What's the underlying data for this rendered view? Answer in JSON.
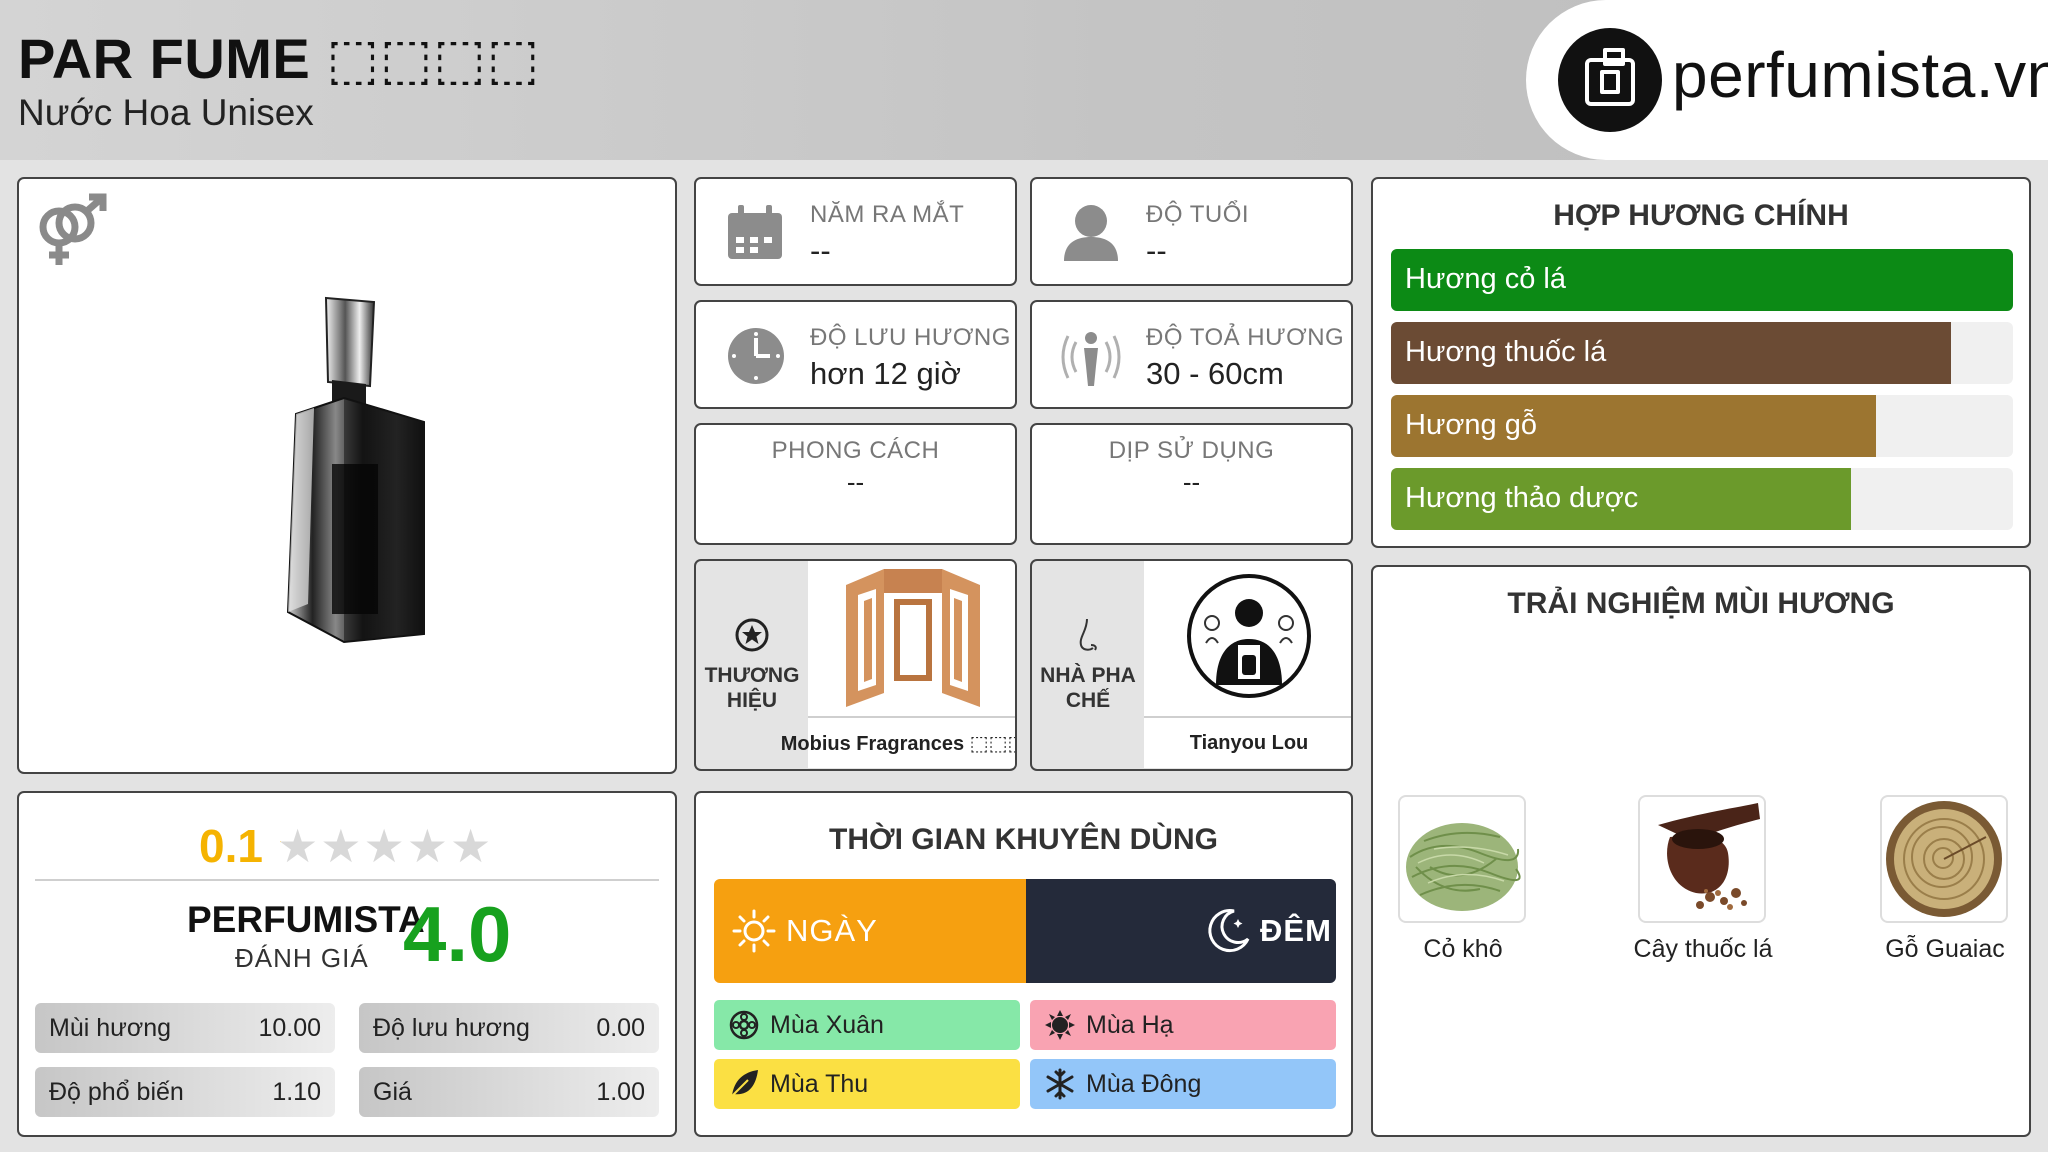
{
  "header": {
    "product_name": "PAR FUME ⬚⬚⬚⬚",
    "product_type": "Nước Hoa Unisex",
    "logo_text": "perfumista.vn"
  },
  "info": {
    "release_year": {
      "label": "NĂM RA MẮT",
      "value": "--",
      "icon": "calendar-icon"
    },
    "age": {
      "label": "ĐỘ TUỔI",
      "value": "--",
      "icon": "person-icon"
    },
    "longevity": {
      "label": "ĐỘ LƯU HƯƠNG",
      "value": "hơn 12 giờ",
      "icon": "clock-icon"
    },
    "sillage": {
      "label": "ĐỘ TOẢ HƯƠNG",
      "value": "30 - 60cm",
      "icon": "sillage-icon"
    },
    "style": {
      "label": "PHONG CÁCH",
      "value": "--"
    },
    "occasion": {
      "label": "DỊP SỬ DỤNG",
      "value": "--"
    }
  },
  "brand": {
    "label": "THƯƠNG HIỆU",
    "name": "Mobius Fragrances ⬚⬚⬚⬚",
    "icon": "star-badge-icon"
  },
  "perfumer": {
    "label": "NHÀ PHA CHẾ",
    "name": "Tianyou Lou",
    "icon": "nose-icon"
  },
  "rating": {
    "user_score": "0.1",
    "user_stars": "★★★★★",
    "user_star_fraction": 0.02,
    "perfumista_label": "PERFUMISTA",
    "perfumista_sub": "ĐÁNH GIÁ",
    "perfumista_score": "4.0",
    "metrics": [
      {
        "label": "Mùi hương",
        "value": "10.00"
      },
      {
        "label": "Độ lưu hương",
        "value": "0.00"
      },
      {
        "label": "Độ phổ biến",
        "value": "1.10"
      },
      {
        "label": "Giá",
        "value": "1.00"
      }
    ]
  },
  "time": {
    "title": "THỜI GIAN KHUYÊN DÙNG",
    "day_label": "NGÀY",
    "night_label": "ĐÊM",
    "seasons": [
      {
        "label": "Mùa Xuân",
        "color": "#86e8a8",
        "icon": "flower-icon"
      },
      {
        "label": "Mùa Hạ",
        "color": "#f9a3b2",
        "icon": "sun-icon"
      },
      {
        "label": "Mùa Thu",
        "color": "#fbe043",
        "icon": "leaf-icon"
      },
      {
        "label": "Mùa Đông",
        "color": "#93c6f9",
        "icon": "snowflake-icon"
      }
    ]
  },
  "accords": {
    "title": "HỢP HƯƠNG CHÍNH",
    "items": [
      {
        "label": "Hương cỏ lá",
        "level": 1.0,
        "color": "#0c8a15"
      },
      {
        "label": "Hương thuốc lá",
        "level": 0.9,
        "color": "#6b4b34"
      },
      {
        "label": "Hương gỗ",
        "level": 0.78,
        "color": "#9c7530"
      },
      {
        "label": "Hương thảo dược",
        "level": 0.74,
        "color": "#6b9a2b"
      }
    ]
  },
  "experience": {
    "title": "TRẢI NGHIỆM MÙI HƯƠNG",
    "notes": [
      {
        "label": "Cỏ khô",
        "icon": "hay-icon"
      },
      {
        "label": "Cây thuốc lá",
        "icon": "tobacco-pipe-icon"
      },
      {
        "label": "Gỗ Guaiac",
        "icon": "wood-slice-icon"
      }
    ]
  }
}
